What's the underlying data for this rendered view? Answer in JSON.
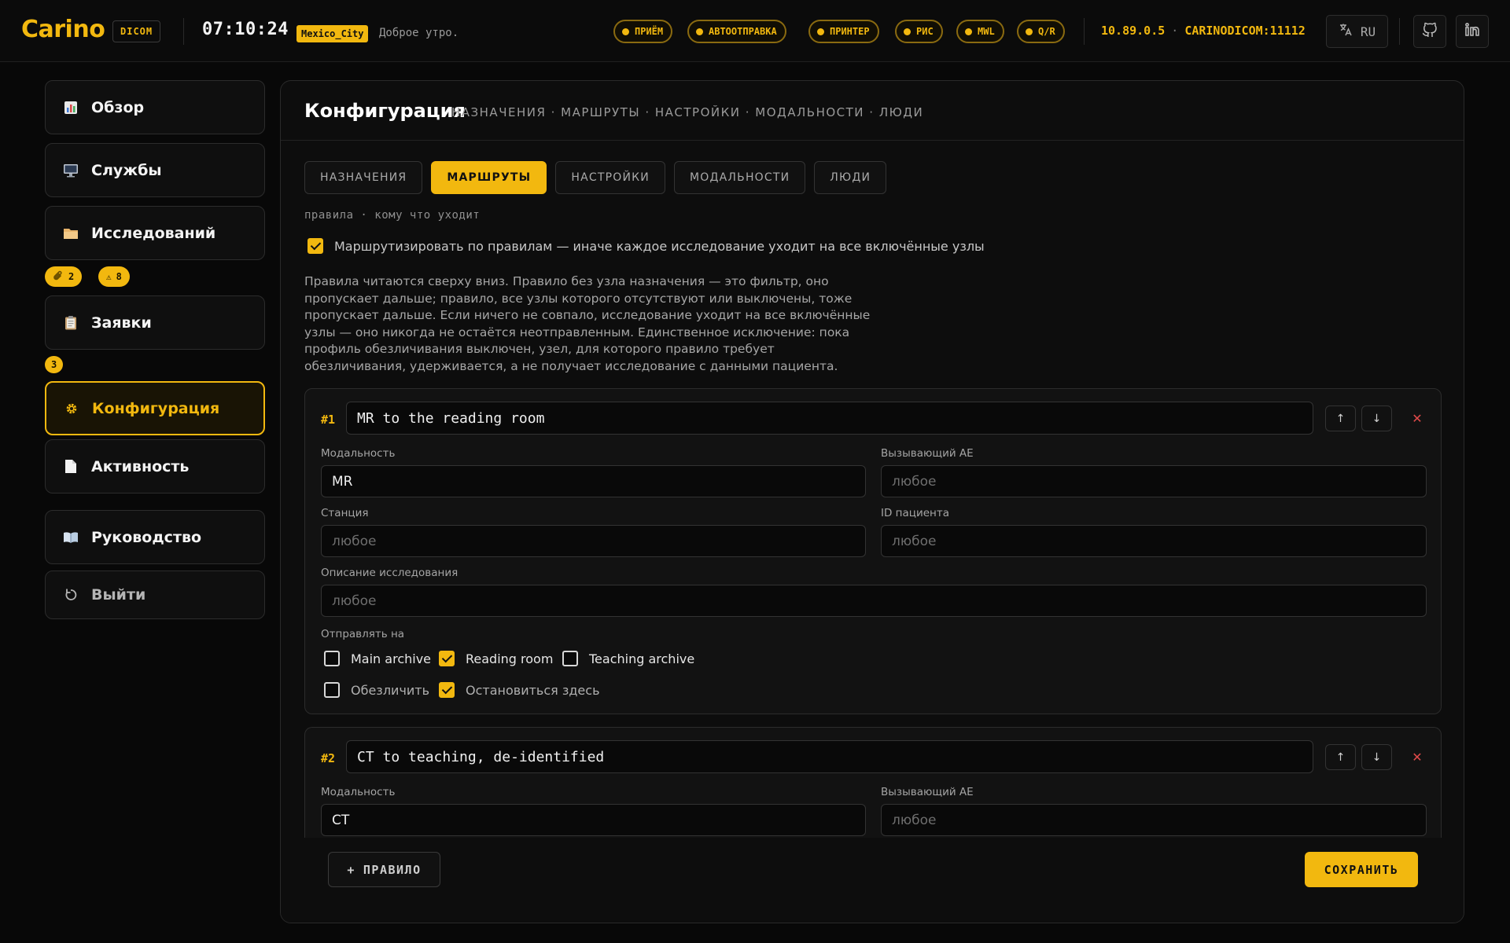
{
  "topbar": {
    "logo": "Carino",
    "badge": "DICOM",
    "clock": "07:10:24",
    "timezone": "Mexico_City",
    "greeting": "Доброе утро.",
    "services": [
      "ПРИЁМ",
      "АВТООТПРАВКА",
      "ПРИНТЕР",
      "РИС",
      "MWL",
      "Q/R"
    ],
    "ip": "10.89.0.5",
    "ae_port": "CARINODICOM:11112",
    "separator": "·",
    "language": "RU",
    "icons": [
      "translate-icon",
      "github-icon",
      "linkedin-icon"
    ],
    "accent_color": "#f2b80f"
  },
  "sidebar": {
    "items": [
      {
        "label": "Обзор",
        "icon": "chart-icon"
      },
      {
        "label": "Службы",
        "icon": "monitor-icon"
      },
      {
        "label": "Исследований",
        "icon": "folder-icon"
      },
      {
        "label": "Заявки",
        "icon": "clipboard-icon"
      },
      {
        "label": "Конфигурация",
        "icon": "gear-icon",
        "active": true
      },
      {
        "label": "Активность",
        "icon": "document-icon"
      },
      {
        "label": "Руководство",
        "icon": "book-icon"
      },
      {
        "label": "Выйти",
        "icon": "logout-icon"
      }
    ],
    "studies_chips": [
      {
        "icon": "paperclip-icon",
        "count": "2"
      },
      {
        "icon": "warning-icon",
        "count": "8"
      }
    ],
    "requests_chip": "3"
  },
  "main": {
    "title": "Конфигурация",
    "breadcrumb": "НАЗНАЧЕНИЯ · МАРШРУТЫ · НАСТРОЙКИ · МОДАЛЬНОСТИ · ЛЮДИ",
    "tabs": [
      {
        "label": "НАЗНАЧЕНИЯ"
      },
      {
        "label": "МАРШРУТЫ",
        "active": true
      },
      {
        "label": "НАСТРОЙКИ"
      },
      {
        "label": "МОДАЛЬНОСТИ"
      },
      {
        "label": "ЛЮДИ"
      }
    ],
    "subhint": "правила · кому что уходит",
    "route_by_rules": {
      "checked": true,
      "label": "Маршрутизировать по правилам — иначе каждое исследование уходит на все включённые узлы"
    },
    "description": "Правила читаются сверху вниз. Правило без узла назначения — это фильтр, оно пропускает дальше; правило, все узлы которого отсутствуют или выключены, тоже пропускает дальше. Если ничего не совпало, исследование уходит на все включённые узлы — оно никогда не остаётся неотправленным. Единственное исключение: пока профиль обезличивания выключен, узел, для которого правило требует обезличивания, удерживается, а не получает исследование с данными пациента.",
    "labels": {
      "modality": "Модальность",
      "calling_ae": "Вызывающий AE",
      "station": "Станция",
      "patient_id": "ID пациента",
      "study_desc": "Описание исследования",
      "send_to": "Отправлять на",
      "any": "любое",
      "deidentify": "Обезличить",
      "stop_here": "Остановиться здесь"
    },
    "rules": [
      {
        "num": "#1",
        "name": "MR to the reading room",
        "modality": "MR",
        "calling_ae": "",
        "station": "",
        "patient_id": "",
        "study_desc": "",
        "destinations": [
          {
            "label": "Main archive",
            "checked": false
          },
          {
            "label": "Reading room",
            "checked": true
          },
          {
            "label": "Teaching archive",
            "checked": false
          }
        ],
        "deidentify": false,
        "stop_here": true
      },
      {
        "num": "#2",
        "name": "CT to teaching, de-identified",
        "modality": "CT",
        "calling_ae": ""
      }
    ],
    "add_rule": "ПРАВИЛО",
    "save": "СОХРАНИТЬ"
  }
}
